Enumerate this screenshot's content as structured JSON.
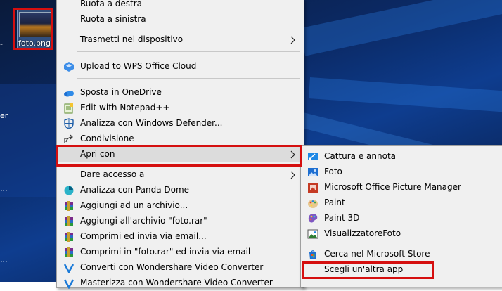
{
  "desktop": {
    "icon_label": "foto.png",
    "edge_texts": [
      "-",
      "er",
      "..."
    ]
  },
  "context_menu": {
    "items": [
      {
        "label": "Ruota a destra"
      },
      {
        "label": "Ruota a sinistra"
      },
      {
        "label": "Trasmetti nel dispositivo"
      },
      {
        "label": "Upload to WPS Office Cloud"
      },
      {
        "label": "Sposta in OneDrive"
      },
      {
        "label": "Edit with Notepad++"
      },
      {
        "label": "Analizza con Windows Defender..."
      },
      {
        "label": "Condivisione"
      },
      {
        "label": "Apri con"
      },
      {
        "label": "Dare accesso a"
      },
      {
        "label": "Analizza con Panda Dome"
      },
      {
        "label": "Aggiungi ad un archivio..."
      },
      {
        "label": "Aggiungi all'archivio \"foto.rar\""
      },
      {
        "label": "Comprimi ed invia via email..."
      },
      {
        "label": "Comprimi in \"foto.rar\" ed invia via email"
      },
      {
        "label": "Converti con Wondershare Video Converter"
      },
      {
        "label": "Masterizza con Wondershare Video Converter"
      }
    ]
  },
  "open_with_menu": {
    "items": [
      {
        "label": "Cattura e annota"
      },
      {
        "label": "Foto"
      },
      {
        "label": "Microsoft Office Picture Manager"
      },
      {
        "label": "Paint"
      },
      {
        "label": "Paint 3D"
      },
      {
        "label": "VisualizzatoreFoto"
      },
      {
        "label": "Cerca nel Microsoft Store"
      },
      {
        "label": "Scegli un'altra app"
      }
    ]
  },
  "colors": {
    "highlight_box": "#d50f0f",
    "menu_bg": "#f0f0f0",
    "hover_bg": "#dcdcdc"
  }
}
